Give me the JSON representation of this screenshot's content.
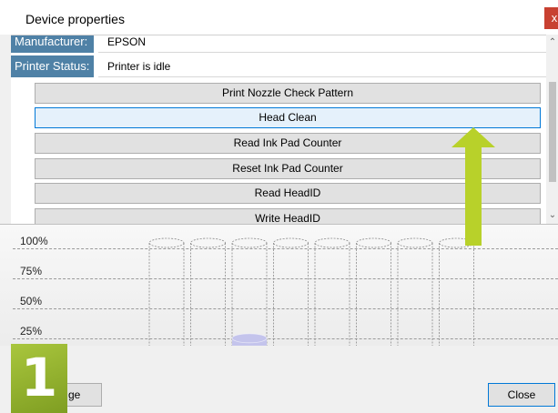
{
  "window": {
    "title": "Device properties",
    "close_glyph": "x"
  },
  "properties": [
    {
      "label": "Manufacturer:",
      "value": "EPSON"
    },
    {
      "label": "Printer Status:",
      "value": "Printer is idle"
    }
  ],
  "actions": [
    {
      "label": "Print Nozzle Check Pattern"
    },
    {
      "label": "Head Clean",
      "focused": true
    },
    {
      "label": "Read Ink Pad Counter"
    },
    {
      "label": "Reset Ink Pad Counter"
    },
    {
      "label": "Read HeadID"
    },
    {
      "label": "Write HeadID"
    }
  ],
  "ink_levels": {
    "scale_labels": [
      "100%",
      "75%",
      "50%",
      "25%"
    ],
    "tanks": [
      {
        "color": "#000000",
        "level": 0.08,
        "unknown": true
      },
      {
        "color": "#000000",
        "level": 0.08,
        "unknown": true
      },
      {
        "color": "#c4c4ec",
        "level": 0.2
      },
      {
        "color": "#b6b6ee",
        "level": 0.08
      },
      {
        "color": "#2a2a2a",
        "level": 0.08
      },
      {
        "color": "#f5f500",
        "level": 0.08
      },
      {
        "color": "#ee18e4",
        "level": 0.08
      },
      {
        "color": "#11e2ea",
        "level": 0.08
      }
    ]
  },
  "footer": {
    "change_label": "ge",
    "close_label": "Close"
  },
  "badge": {
    "number": "1"
  },
  "colors": {
    "label_bg": "#4f81a6",
    "arrow": "#b8d12a",
    "badge": "#94b330",
    "close_x_bg": "#c84031"
  },
  "icons": {
    "arrow": "up-arrow-icon",
    "scroll_up": "chevron-up-icon",
    "scroll_down": "chevron-down-icon"
  }
}
